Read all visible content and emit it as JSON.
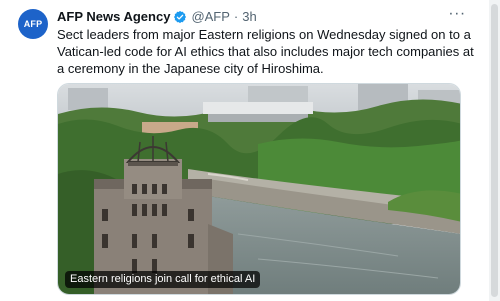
{
  "tweet": {
    "avatar_text": "AFP",
    "author_name": "AFP News Agency",
    "handle": "@AFP",
    "separator": "·",
    "time": "3h",
    "more_label": "···",
    "text": "Sect leaders from major Eastern religions on Wednesday signed on to a Vatican-led code for AI ethics that also includes major tech companies at a ceremony in the Japanese city of Hiroshima.",
    "media": {
      "caption": "Eastern religions join call for ethical AI"
    }
  },
  "colors": {
    "verified_badge": "#1d9bf0",
    "avatar_bg": "#1d63c9",
    "secondary_text": "#536471"
  },
  "icons": {
    "verified": "verified-badge-icon",
    "more": "more-options-icon"
  }
}
